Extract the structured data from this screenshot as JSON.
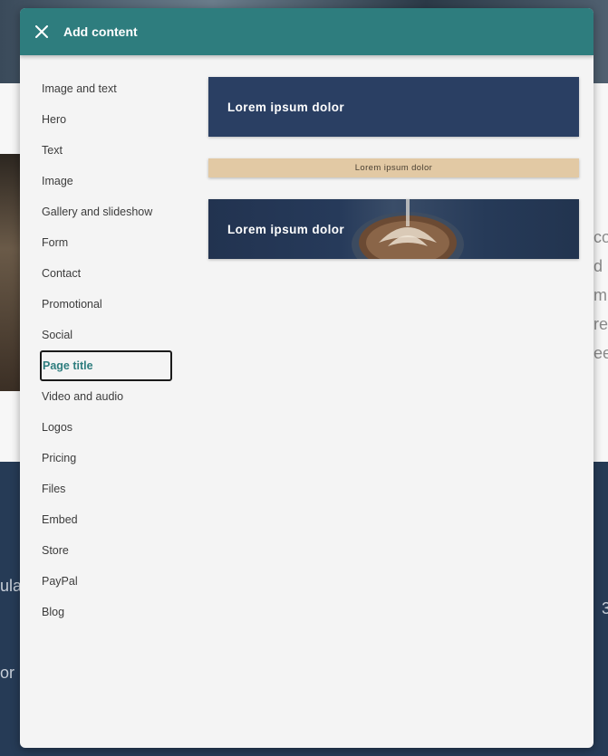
{
  "background": {
    "right_fragments": [
      "co",
      "d",
      "m",
      "re",
      "ee"
    ],
    "left_fragment_1": "ula",
    "left_fragment_2": "or",
    "right_fragment_dark": "3"
  },
  "modal": {
    "title": "Add content",
    "close_icon": "close-icon",
    "categories": [
      {
        "label": "Image and text"
      },
      {
        "label": "Hero"
      },
      {
        "label": "Text"
      },
      {
        "label": "Image"
      },
      {
        "label": "Gallery and slideshow"
      },
      {
        "label": "Form"
      },
      {
        "label": "Contact"
      },
      {
        "label": "Promotional"
      },
      {
        "label": "Social"
      },
      {
        "label": "Page title"
      },
      {
        "label": "Video and audio"
      },
      {
        "label": "Logos"
      },
      {
        "label": "Pricing"
      },
      {
        "label": "Files"
      },
      {
        "label": "Embed"
      },
      {
        "label": "Store"
      },
      {
        "label": "PayPal"
      },
      {
        "label": "Blog"
      }
    ],
    "selected_category": "Page title",
    "templates": [
      {
        "text": "Lorem ipsum dolor"
      },
      {
        "text": "Lorem ipsum dolor"
      },
      {
        "text": "Lorem ipsum dolor"
      }
    ]
  },
  "colors": {
    "header": "#2e7d7e",
    "selected_text": "#2e7d7e",
    "template_dark": "#2a3f63",
    "template_tan": "#e2c9a4",
    "background_dark": "#263b56"
  }
}
